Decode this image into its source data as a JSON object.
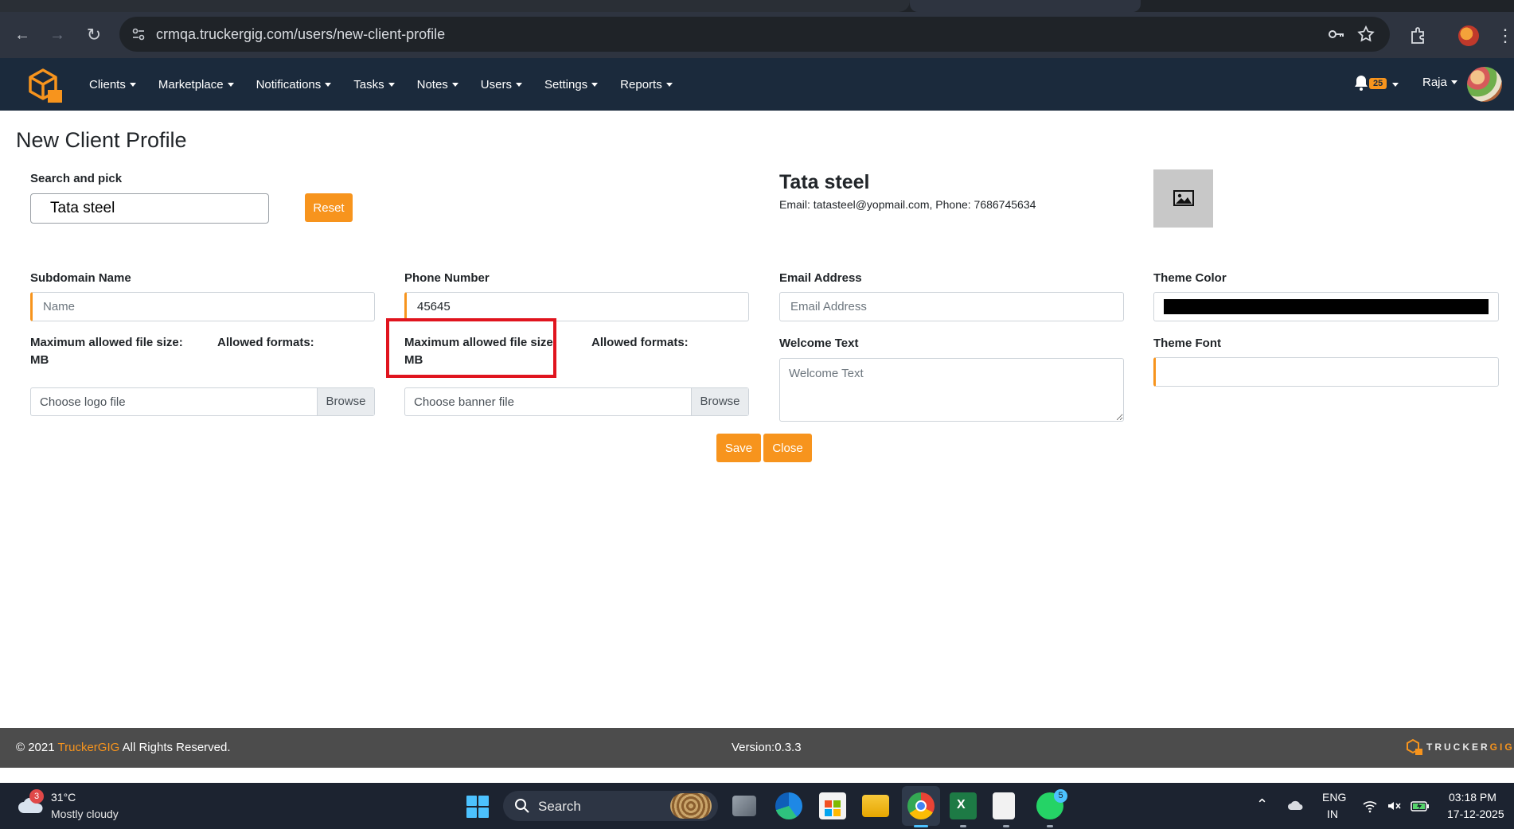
{
  "browser": {
    "url": "crmqa.truckergig.com/users/new-client-profile"
  },
  "navbar": {
    "menu": [
      {
        "label": "Clients"
      },
      {
        "label": "Marketplace"
      },
      {
        "label": "Notifications"
      },
      {
        "label": "Tasks"
      },
      {
        "label": "Notes"
      },
      {
        "label": "Users"
      },
      {
        "label": "Settings"
      },
      {
        "label": "Reports"
      }
    ],
    "notification_count": "25",
    "user_name": "Raja"
  },
  "page": {
    "title": "New Client Profile",
    "search_label": "Search and pick",
    "search_value": "Tata steel",
    "reset_label": "Reset",
    "company": {
      "name": "Tata steel",
      "contact": "Email: tatasteel@yopmail.com, Phone: 7686745634"
    },
    "fields": {
      "subdomain_label": "Subdomain Name",
      "subdomain_placeholder": "Name",
      "phone_label": "Phone Number",
      "phone_value": "45645",
      "email_label": "Email Address",
      "email_placeholder": "Email Address",
      "theme_color_label": "Theme Color",
      "theme_color_value": "#000000",
      "welcome_label": "Welcome Text",
      "welcome_placeholder": "Welcome Text",
      "theme_font_label": "Theme Font",
      "logo_max_size": "Maximum allowed file size:",
      "logo_unit": "MB",
      "logo_formats": "Allowed formats:",
      "banner_max_size": "Maximum allowed file size:",
      "banner_unit": "MB",
      "banner_formats": "Allowed formats:",
      "logo_file_placeholder": "Choose logo file",
      "banner_file_placeholder": "Choose banner file",
      "browse_label": "Browse"
    },
    "save_label": "Save",
    "close_label": "Close"
  },
  "footer": {
    "copyright_prefix": "© 2021 ",
    "brand": "TruckerGIG",
    "copyright_suffix": " All Rights Reserved.",
    "version": "Version:0.3.3",
    "logo_text_a": "TRUCKER",
    "logo_text_b": "GIG"
  },
  "taskbar": {
    "weather_badge": "3",
    "temperature": "31°C",
    "weather": "Mostly cloudy",
    "search_label": "Search",
    "whatsapp_badge": "5",
    "lang_top": "ENG",
    "lang_bottom": "IN",
    "time": "03:18 PM",
    "date": "17-12-2025"
  },
  "colors": {
    "accent": "#f7941d",
    "navbar_bg": "#1b2a3c",
    "footer_bg": "#4c4c4c",
    "highlight": "#e0141e"
  }
}
